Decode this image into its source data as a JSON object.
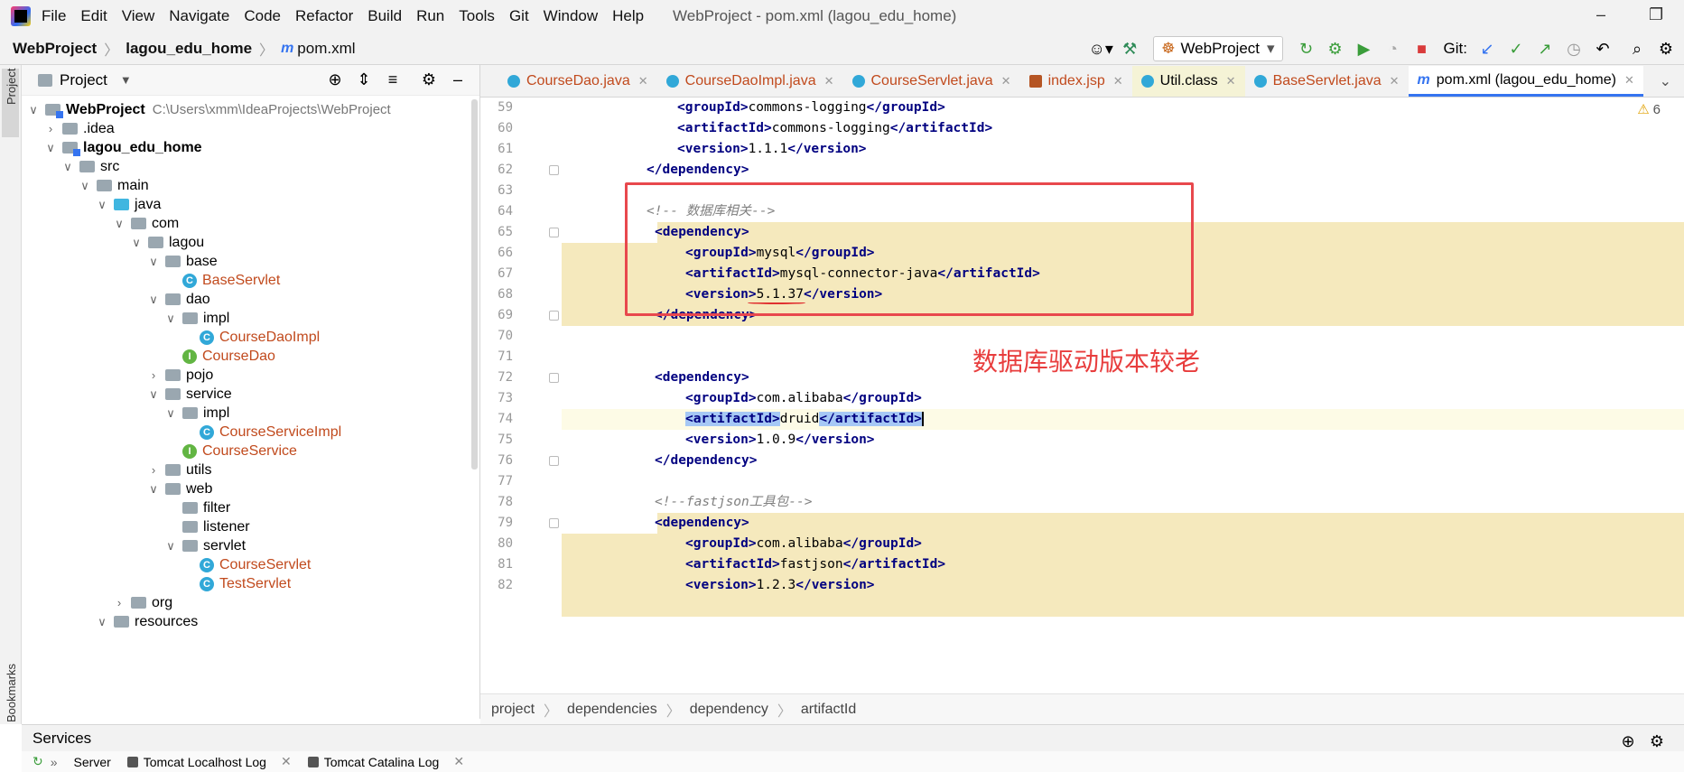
{
  "menubar": {
    "items": [
      "File",
      "Edit",
      "View",
      "Navigate",
      "Code",
      "Refactor",
      "Build",
      "Run",
      "Tools",
      "Git",
      "Window",
      "Help"
    ],
    "title": "WebProject - pom.xml (lagou_edu_home)"
  },
  "navbar": {
    "crumbs": [
      "WebProject",
      "lagou_edu_home"
    ],
    "file": "pom.xml",
    "run_config": "WebProject",
    "git_label": "Git:"
  },
  "left_strip": {
    "project": "Project",
    "bookmarks": "Bookmarks"
  },
  "project_panel": {
    "title": "Project",
    "tree": [
      {
        "label": "WebProject",
        "path": "C:\\Users\\xmm\\IdeaProjects\\WebProject"
      },
      {
        "label": ".idea"
      },
      {
        "label": "lagou_edu_home"
      },
      {
        "label": "src"
      },
      {
        "label": "main"
      },
      {
        "label": "java"
      },
      {
        "label": "com"
      },
      {
        "label": "lagou"
      },
      {
        "label": "base"
      },
      {
        "label": "BaseServlet"
      },
      {
        "label": "dao"
      },
      {
        "label": "impl"
      },
      {
        "label": "CourseDaoImpl"
      },
      {
        "label": "CourseDao"
      },
      {
        "label": "pojo"
      },
      {
        "label": "service"
      },
      {
        "label": "impl"
      },
      {
        "label": "CourseServiceImpl"
      },
      {
        "label": "CourseService"
      },
      {
        "label": "utils"
      },
      {
        "label": "web"
      },
      {
        "label": "filter"
      },
      {
        "label": "listener"
      },
      {
        "label": "servlet"
      },
      {
        "label": "CourseServlet"
      },
      {
        "label": "TestServlet"
      },
      {
        "label": "org"
      },
      {
        "label": "resources"
      }
    ]
  },
  "editor": {
    "tabs": [
      {
        "label": "CourseDao.java"
      },
      {
        "label": "CourseDaoImpl.java"
      },
      {
        "label": "CourseServlet.java"
      },
      {
        "label": "index.jsp"
      },
      {
        "label": "Util.class"
      },
      {
        "label": "BaseServlet.java"
      },
      {
        "label": "pom.xml (lagou_edu_home)"
      }
    ],
    "warning_count": "6",
    "line_numbers": [
      "59",
      "60",
      "61",
      "62",
      "63",
      "64",
      "65",
      "66",
      "67",
      "68",
      "69",
      "70",
      "71",
      "72",
      "73",
      "74",
      "75",
      "76",
      "77",
      "78",
      "79",
      "80",
      "81",
      "82"
    ],
    "code": {
      "l59_val": "commons-logging",
      "l60_val": "commons-logging",
      "l61_val": "1.1.1",
      "l64_comment": "<!-- 数据库相关-->",
      "l66_val": "mysql",
      "l67_val": "mysql-connector-java",
      "l68_val": "5.1.37",
      "l73_val": "com.alibaba",
      "l74_val": "druid",
      "l75_val": "1.0.9",
      "l78_comment": "<!--fastjson工具包-->",
      "l80_val": "com.alibaba",
      "l81_val": "fastjson",
      "l82_val": "1.2.3"
    },
    "annotation": "数据库驱动版本较老",
    "breadcrumb": [
      "project",
      "dependencies",
      "dependency",
      "artifactId"
    ]
  },
  "bottom": {
    "services_title": "Services",
    "tabs": [
      "Server",
      "Tomcat Localhost Log",
      "Tomcat Catalina Log"
    ]
  },
  "colors": {
    "accent": "#3574f0",
    "xml_tag": "#000080",
    "highlight_band": "#f5e9bd",
    "annotation_red": "#e8484d",
    "class_name": "#c14a1d"
  }
}
